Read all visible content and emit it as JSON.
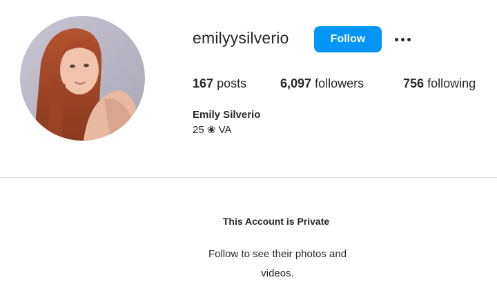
{
  "profile": {
    "username": "emilyysilverio",
    "follow_label": "Follow",
    "more_icon": "more-horizontal-icon",
    "avatar_icon": "profile-photo",
    "accent_color": "#0095f6",
    "stats": {
      "posts_count": "167",
      "posts_label": "posts",
      "followers_count": "6,097",
      "followers_label": "followers",
      "following_count": "756",
      "following_label": "following"
    },
    "full_name": "Emily Silverio",
    "bio": "25 ❀ VA"
  },
  "private_notice": {
    "title": "This Account is Private",
    "message": "Follow to see their photos and videos."
  }
}
